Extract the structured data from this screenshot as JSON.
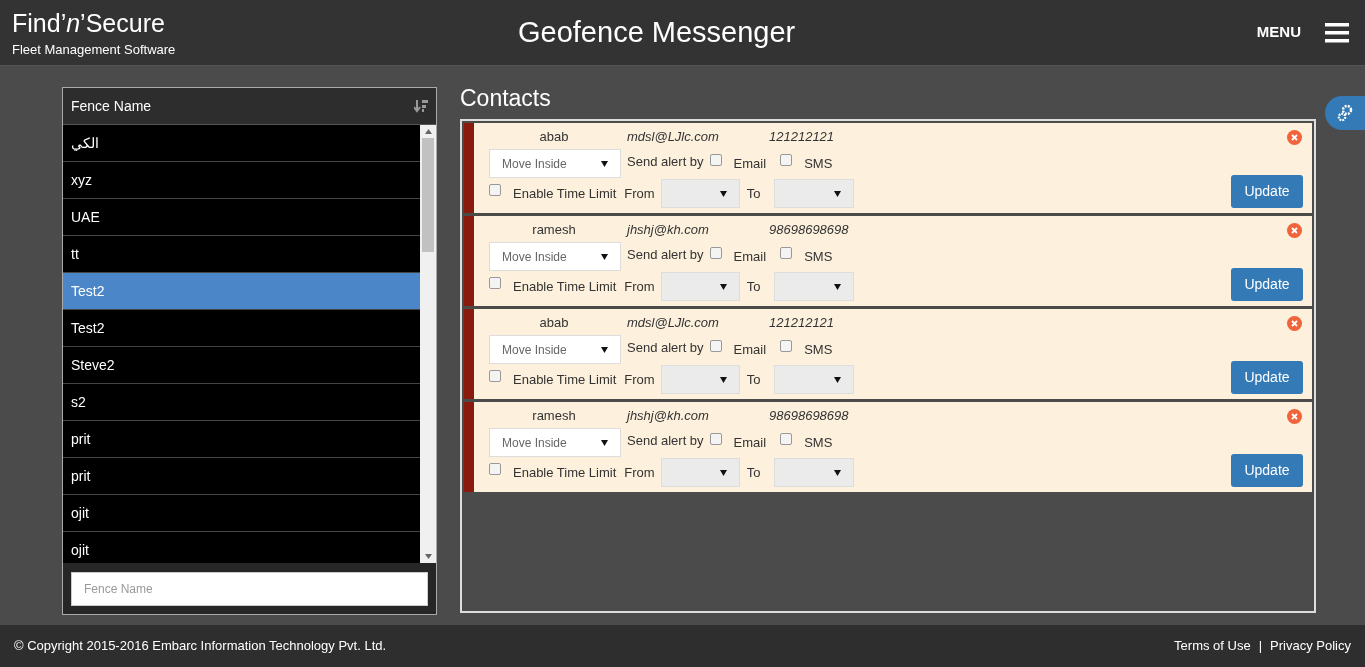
{
  "header": {
    "logo": "Find’*n*’Secure",
    "tagline": "Fleet Management Software",
    "title": "Geofence Messenger",
    "menu_label": "MENU"
  },
  "fence_list": {
    "column": "Fence Name",
    "search_placeholder": "Fence Name",
    "items": [
      {
        "name": "الكي",
        "selected": false
      },
      {
        "name": "xyz",
        "selected": false
      },
      {
        "name": "UAE",
        "selected": false
      },
      {
        "name": "tt",
        "selected": false
      },
      {
        "name": "Test2",
        "selected": true
      },
      {
        "name": "Test2",
        "selected": false
      },
      {
        "name": "Steve2",
        "selected": false
      },
      {
        "name": "s2",
        "selected": false
      },
      {
        "name": "prit",
        "selected": false
      },
      {
        "name": "prit",
        "selected": false
      },
      {
        "name": "ojit",
        "selected": false
      },
      {
        "name": "ojit",
        "selected": false
      }
    ]
  },
  "contacts": {
    "title": "Contacts",
    "items": [
      {
        "name": "abab",
        "email": "mdsl@LJlc.com",
        "phone": "121212121",
        "event": "Move Inside",
        "send_alert_label": "Send alert by",
        "email_label": "Email",
        "email_checked": false,
        "sms_label": "SMS",
        "sms_checked": false,
        "time_limit_label": "Enable Time Limit",
        "time_limit_checked": false,
        "from_label": "From",
        "to_label": "To",
        "button": "Update"
      },
      {
        "name": "ramesh",
        "email": "jhshj@kh.com",
        "phone": "98698698698",
        "event": "Move Inside",
        "send_alert_label": "Send alert by",
        "email_label": "Email",
        "email_checked": false,
        "sms_label": "SMS",
        "sms_checked": false,
        "time_limit_label": "Enable Time Limit",
        "time_limit_checked": false,
        "from_label": "From",
        "to_label": "To",
        "button": "Update"
      },
      {
        "name": "abab",
        "email": "mdsl@LJlc.com",
        "phone": "121212121",
        "event": "Move Inside",
        "send_alert_label": "Send alert by",
        "email_label": "Email",
        "email_checked": false,
        "sms_label": "SMS",
        "sms_checked": false,
        "time_limit_label": "Enable Time Limit",
        "time_limit_checked": false,
        "from_label": "From",
        "to_label": "To",
        "button": "Update"
      },
      {
        "name": "ramesh",
        "email": "jhshj@kh.com",
        "phone": "98698698698",
        "event": "Move Inside",
        "send_alert_label": "Send alert by",
        "email_label": "Email",
        "email_checked": false,
        "sms_label": "SMS",
        "sms_checked": false,
        "time_limit_label": "Enable Time Limit",
        "time_limit_checked": false,
        "from_label": "From",
        "to_label": "To",
        "button": "Update"
      }
    ]
  },
  "footer": {
    "copyright": "© Copyright 2015-2016 Embarc Information Technology Pvt. Ltd.",
    "links": [
      "Terms of Use",
      "Privacy Policy"
    ],
    "separator": "|"
  }
}
